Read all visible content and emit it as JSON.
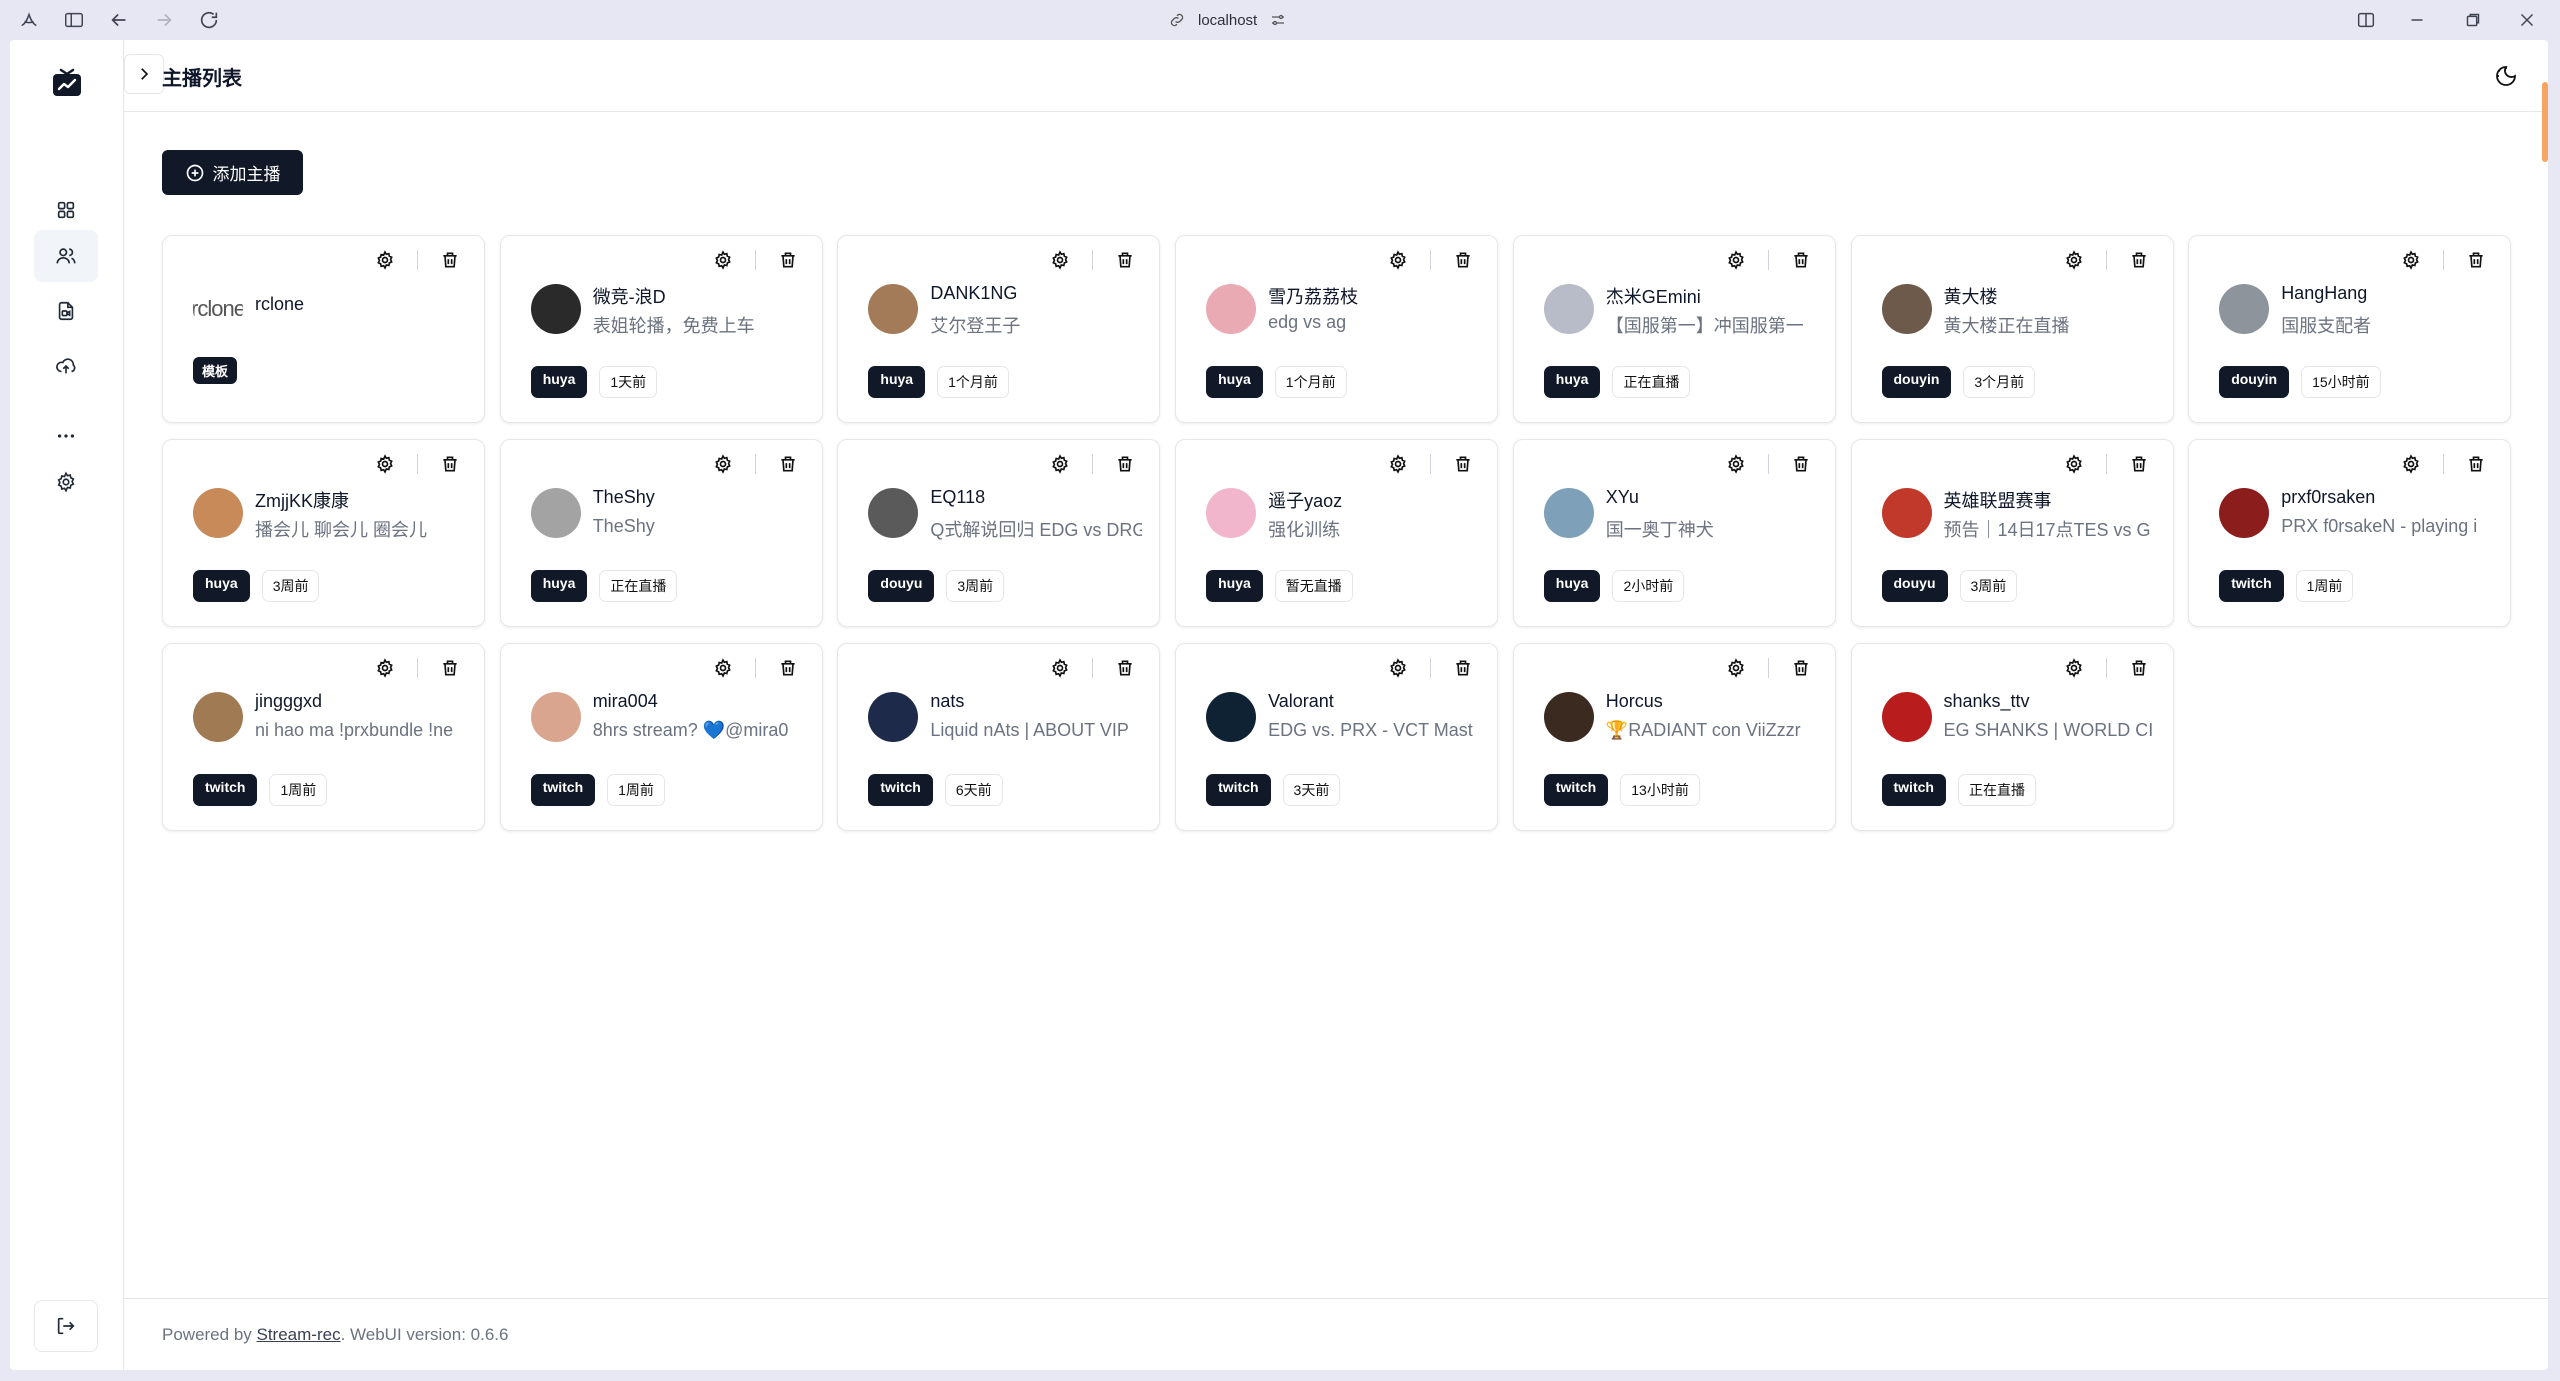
{
  "browser": {
    "url": "localhost"
  },
  "header": {
    "title": "主播列表"
  },
  "actions": {
    "add_label": "添加主播"
  },
  "template_card": {
    "name": "rclone",
    "avatar_text": "rclone",
    "tag": "模板"
  },
  "streamers": [
    {
      "name": "微竞-浪D",
      "desc": "表姐轮播，免费上车",
      "platform": "huya",
      "status": "1天前",
      "color": "#2a2a2a"
    },
    {
      "name": "DANK1NG",
      "desc": "艾尔登王子",
      "platform": "huya",
      "status": "1个月前",
      "color": "#a37b58"
    },
    {
      "name": "雪乃荔荔枝",
      "desc": "edg vs ag",
      "platform": "huya",
      "status": "1个月前",
      "color": "#e9aab4"
    },
    {
      "name": "杰米GEmini",
      "desc": "【国服第一】冲国服第一",
      "platform": "huya",
      "status": "正在直播",
      "color": "#b8bcc8"
    },
    {
      "name": "黄大楼",
      "desc": "黄大楼正在直播",
      "platform": "douyin",
      "status": "3个月前",
      "color": "#6e5a4a"
    },
    {
      "name": "HangHang",
      "desc": "国服支配者",
      "platform": "douyin",
      "status": "15小时前",
      "color": "#8e949c"
    },
    {
      "name": "ZmjjKK康康",
      "desc": "播会儿 聊会儿 圈会儿",
      "platform": "huya",
      "status": "3周前",
      "color": "#c98a5a"
    },
    {
      "name": "TheShy",
      "desc": "TheShy",
      "platform": "huya",
      "status": "正在直播",
      "color": "#a3a3a3"
    },
    {
      "name": "EQ118",
      "desc": "Q式解说回归 EDG vs DRG",
      "platform": "douyu",
      "status": "3周前",
      "color": "#5a5a5a"
    },
    {
      "name": "遥子yaoz",
      "desc": "强化训练",
      "platform": "huya",
      "status": "暂无直播",
      "color": "#f2b6cc"
    },
    {
      "name": "XYu",
      "desc": "国一奥丁神犬",
      "platform": "huya",
      "status": "2小时前",
      "color": "#7ea0b8"
    },
    {
      "name": "英雄联盟赛事",
      "desc": "预告｜14日17点TES vs G",
      "platform": "douyu",
      "status": "3周前",
      "color": "#c0392b"
    },
    {
      "name": "prxf0rsaken",
      "desc": "PRX f0rsakeN - playing i",
      "platform": "twitch",
      "status": "1周前",
      "color": "#8b1d1d"
    },
    {
      "name": "jingggxd",
      "desc": "ni hao ma !prxbundle !ne",
      "platform": "twitch",
      "status": "1周前",
      "color": "#a07a52"
    },
    {
      "name": "mira004",
      "desc": "8hrs stream? 💙@mira0",
      "platform": "twitch",
      "status": "1周前",
      "color": "#d9a58e"
    },
    {
      "name": "nats",
      "desc": "Liquid nAts | ABOUT VIP",
      "platform": "twitch",
      "status": "6天前",
      "color": "#1e2a4a"
    },
    {
      "name": "Valorant",
      "desc": "EDG vs. PRX - VCT Mast",
      "platform": "twitch",
      "status": "3天前",
      "color": "#0f2233"
    },
    {
      "name": "Horcus",
      "desc": "🏆RADIANT con ViiZzzr",
      "platform": "twitch",
      "status": "13小时前",
      "color": "#3b2a20"
    },
    {
      "name": "shanks_ttv",
      "desc": "EG SHANKS | WORLD CI",
      "platform": "twitch",
      "status": "正在直播",
      "color": "#b91c1c"
    }
  ],
  "footer": {
    "prefix": "Powered by ",
    "link": "Stream-rec",
    "suffix": ". WebUI version: 0.6.6"
  }
}
